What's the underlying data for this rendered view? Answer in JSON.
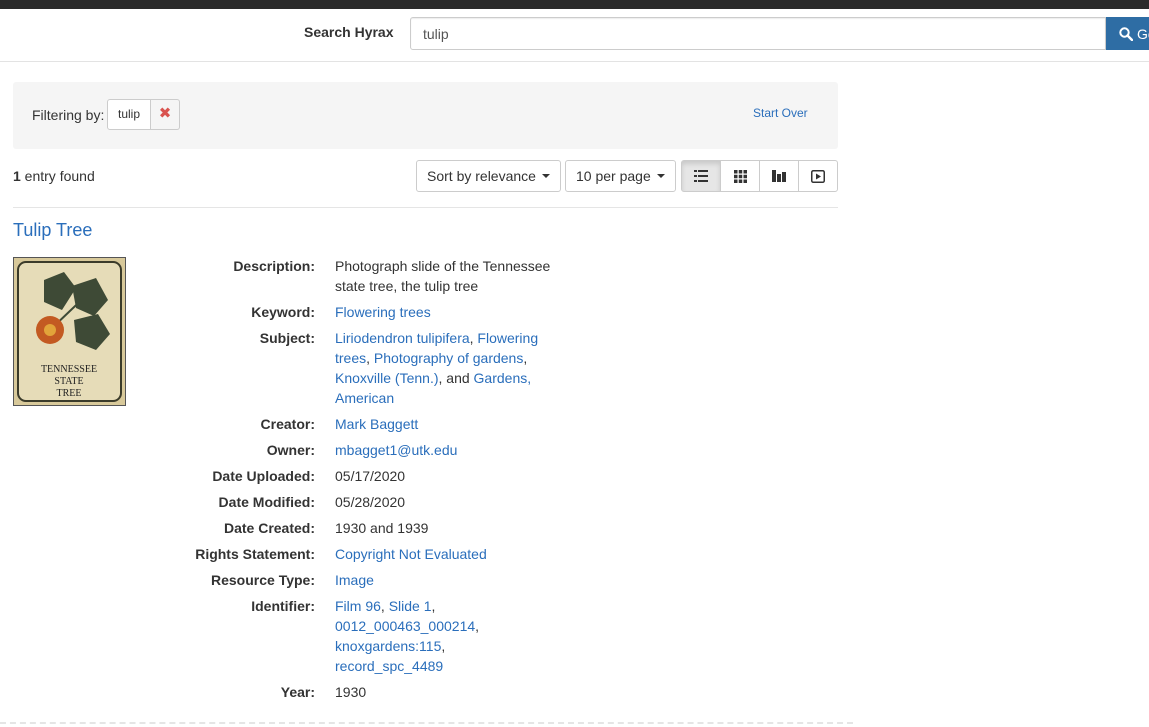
{
  "search": {
    "label": "Search Hyrax",
    "value": "tulip",
    "go_label": "Go"
  },
  "filters": {
    "label": "Filtering by:",
    "chips": [
      {
        "value": "tulip",
        "remove": "✖"
      }
    ],
    "start_over": "Start Over"
  },
  "results": {
    "count": "1",
    "count_suffix": " entry found",
    "sort_label": "Sort by relevance",
    "per_page_label": "10 per page",
    "views": [
      "list-icon",
      "gallery-icon",
      "masonry-icon",
      "slideshow-icon"
    ]
  },
  "item": {
    "title": "Tulip Tree",
    "thumbnail_text": [
      "TENNESSEE",
      "STATE",
      "TREE"
    ],
    "fields": {
      "description": {
        "key": "Description:",
        "value": "Photograph slide of the Tennessee state tree, the tulip tree"
      },
      "keyword": {
        "key": "Keyword:",
        "value": "Flowering trees"
      },
      "subject": {
        "key": "Subject:",
        "links": [
          "Liriodendron tulipifera",
          "Flowering trees",
          "Photography of gardens",
          "Knoxville (Tenn.)",
          "Gardens, American"
        ],
        "sep1": ", ",
        "sep2": ", ",
        "sep3": ", ",
        "sep4": ", and "
      },
      "creator": {
        "key": "Creator:",
        "value": "Mark Baggett"
      },
      "owner": {
        "key": "Owner:",
        "value": "mbagget1@utk.edu"
      },
      "date_uploaded": {
        "key": "Date Uploaded:",
        "value": "05/17/2020"
      },
      "date_modified": {
        "key": "Date Modified:",
        "value": "05/28/2020"
      },
      "date_created": {
        "key": "Date Created:",
        "value": "1930 and 1939"
      },
      "rights": {
        "key": "Rights Statement:",
        "value": "Copyright Not Evaluated"
      },
      "resource_type": {
        "key": "Resource Type:",
        "value": "Image"
      },
      "identifier": {
        "key": "Identifier:",
        "links": [
          "Film 96",
          "Slide 1",
          "0012_000463_000214",
          "knoxgardens:115",
          "record_spc_4489"
        ],
        "sep": ","
      },
      "year": {
        "key": "Year:",
        "value": "1930"
      }
    }
  },
  "colors": {
    "link": "#2a6ebb",
    "primary": "#2e6da4",
    "danger": "#d9534f",
    "panel": "#f5f5f5"
  }
}
